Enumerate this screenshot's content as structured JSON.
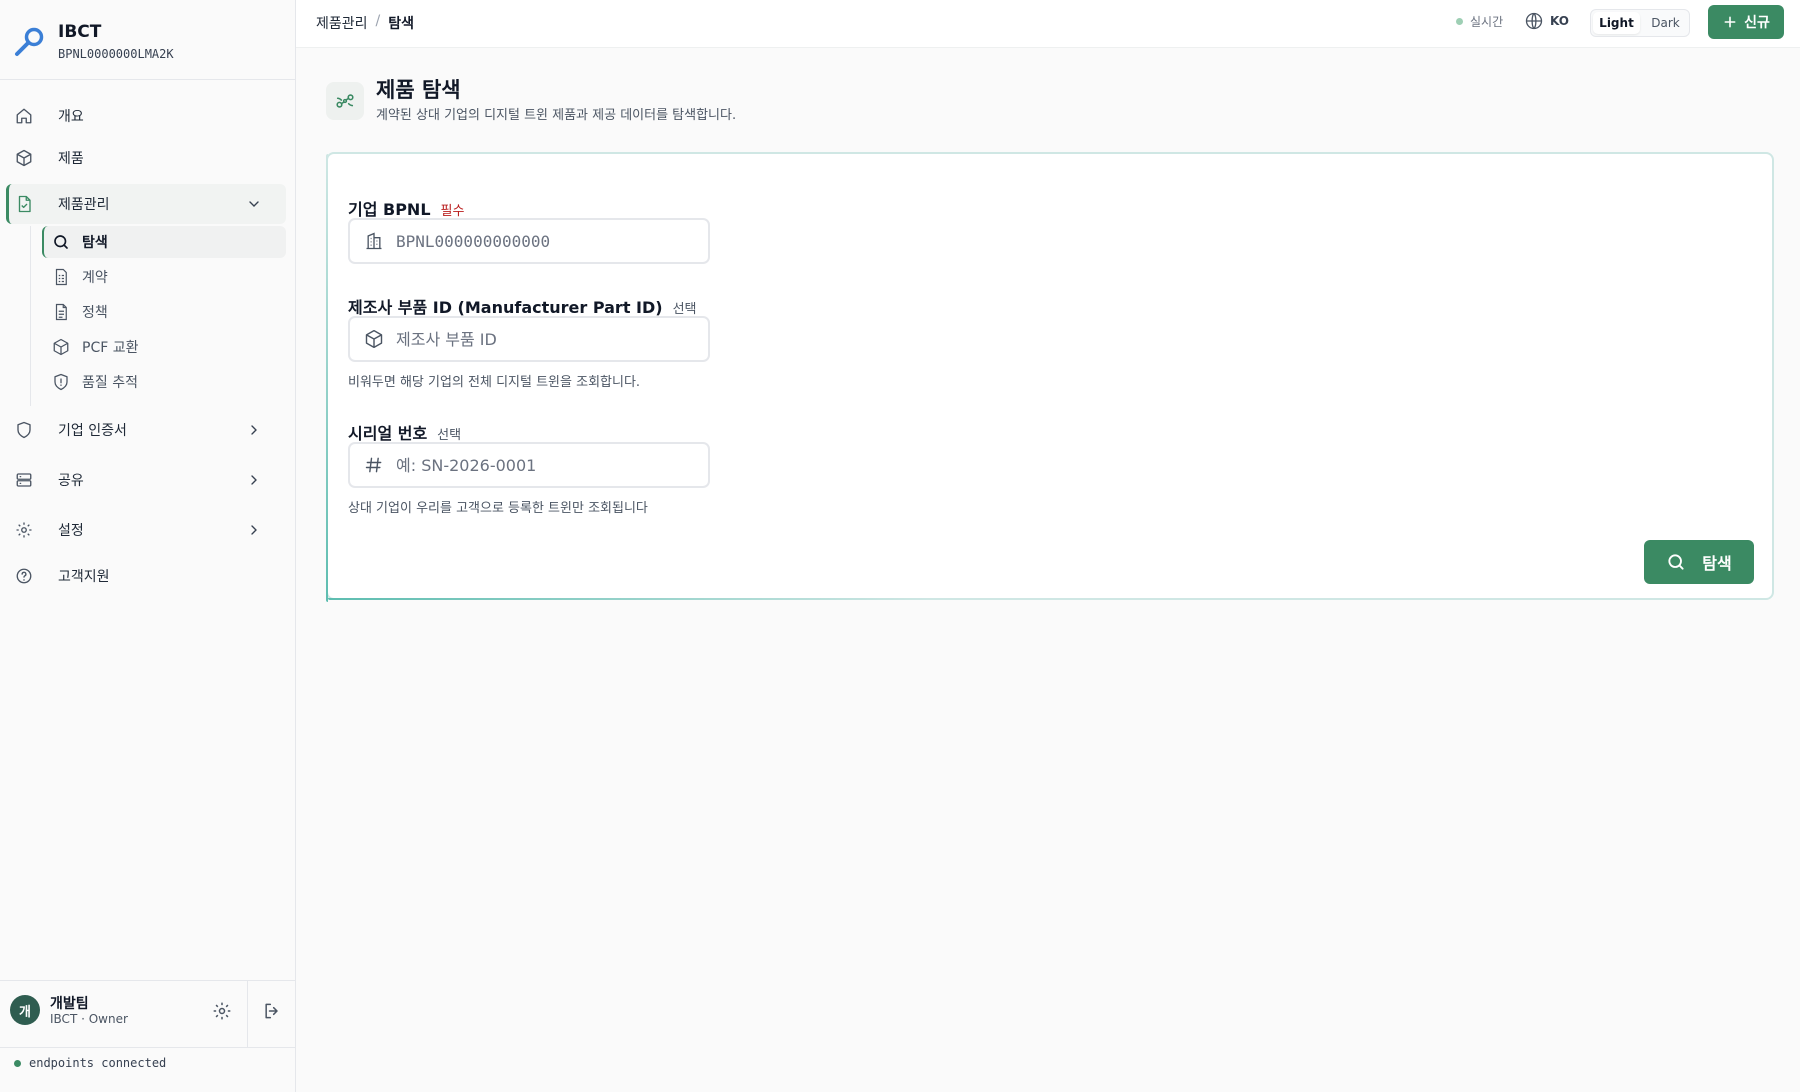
{
  "brand": {
    "name": "IBCT",
    "id": "BPNL0000000LMA2K"
  },
  "sidebar": {
    "items": [
      {
        "label": "개요",
        "icon": "home-icon"
      },
      {
        "label": "제품",
        "icon": "cube-icon"
      },
      {
        "label": "제품관리",
        "icon": "file-check-icon"
      },
      {
        "label": "기업 인증서",
        "icon": "shield-icon"
      },
      {
        "label": "공유",
        "icon": "server-icon"
      },
      {
        "label": "설정",
        "icon": "gear-icon"
      },
      {
        "label": "고객지원",
        "icon": "help-icon"
      }
    ],
    "sub_items": [
      {
        "label": "탐색",
        "icon": "search-icon"
      },
      {
        "label": "계약",
        "icon": "contract-icon"
      },
      {
        "label": "정책",
        "icon": "document-icon"
      },
      {
        "label": "PCF 교환",
        "icon": "cube-icon"
      },
      {
        "label": "품질 추적",
        "icon": "shield-alert-icon"
      }
    ]
  },
  "user": {
    "initial": "개",
    "name": "개발팀",
    "role": "IBCT · Owner"
  },
  "status": {
    "connection": "endpoints connected"
  },
  "topbar": {
    "breadcrumb_parent": "제품관리",
    "breadcrumb_sep": "/",
    "breadcrumb_current": "탐색",
    "live_label": "실시간",
    "lang_label": "KO",
    "theme_light": "Light",
    "theme_dark": "Dark",
    "new_button": "신규"
  },
  "page": {
    "title": "제품 탐색",
    "subtitle": "계약된 상대 기업의 디지털 트윈 제품과 제공 데이터를 탐색합니다."
  },
  "form": {
    "bpnl": {
      "label": "기업 BPNL",
      "badge": "필수",
      "placeholder": "BPNL000000000000",
      "value": ""
    },
    "part": {
      "label": "제조사 부품 ID (Manufacturer Part ID)",
      "badge": "선택",
      "placeholder": "제조사 부품 ID",
      "value": "",
      "help": "비워두면 해당 기업의 전체 디지털 트윈을 조회합니다."
    },
    "serial": {
      "label": "시리얼 번호",
      "badge": "선택",
      "placeholder": "예: SN-2026-0001",
      "value": "",
      "help": "상대 기업이 우리를 고객으로 등록한 트윈만 조회됩니다"
    },
    "submit_label": "탐색"
  },
  "colors": {
    "accent": "#3b8a63",
    "required": "#b91c1c",
    "card_border": "#cfe7e4"
  }
}
